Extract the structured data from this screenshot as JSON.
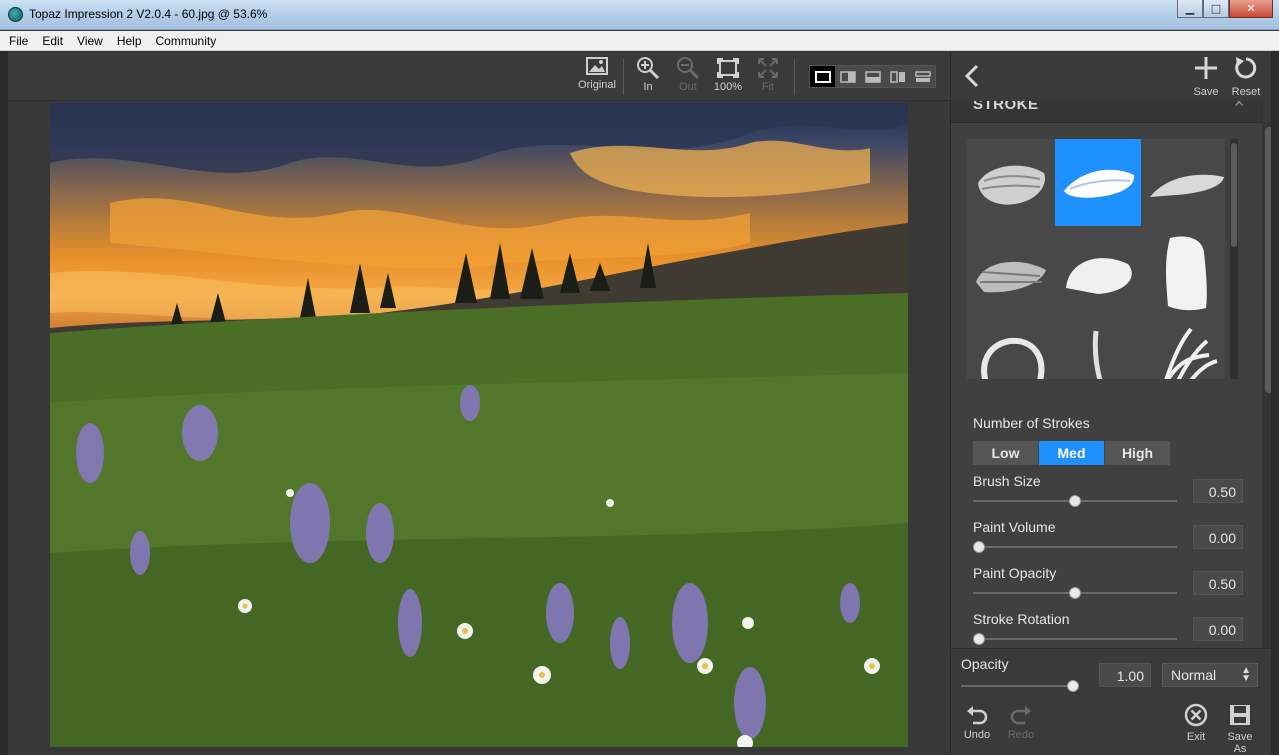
{
  "window": {
    "title": "Topaz Impression 2 V2.0.4 - 60.jpg @ 53.6%",
    "minimize": "▁",
    "maximize": "□",
    "close": "✕"
  },
  "menu": [
    "File",
    "Edit",
    "View",
    "Help",
    "Community"
  ],
  "toolbar": {
    "original": "Original",
    "zoom_in": "In",
    "zoom_out": "Out",
    "zoom_100": "100%",
    "fit": "Fit"
  },
  "panel": {
    "save": "Save",
    "reset": "Reset",
    "section_title": "STROKE",
    "brushes": [
      "brush-1",
      "brush-2",
      "brush-3",
      "brush-4",
      "brush-5",
      "brush-6",
      "brush-7",
      "brush-8",
      "brush-9"
    ],
    "selected_brush": 1,
    "number_of_strokes_label": "Number of Strokes",
    "strokes_options": [
      "Low",
      "Med",
      "High"
    ],
    "strokes_selected": "Med",
    "sliders": [
      {
        "label": "Brush Size",
        "value": "0.50",
        "level": 0.5
      },
      {
        "label": "Paint Volume",
        "value": "0.00",
        "level": 0.0
      },
      {
        "label": "Paint Opacity",
        "value": "0.50",
        "level": 0.5
      },
      {
        "label": "Stroke Rotation",
        "value": "0.00",
        "level": 0.0
      }
    ],
    "opacity": {
      "label": "Opacity",
      "value": "1.00",
      "level": 1.0
    },
    "blend_mode": "Normal",
    "undo": "Undo",
    "redo": "Redo",
    "exit": "Exit",
    "save_as": "Save As"
  },
  "colors": {
    "accent": "#1e90ff",
    "panel_bg": "#3a3a3a",
    "text": "#e6e6e6"
  }
}
